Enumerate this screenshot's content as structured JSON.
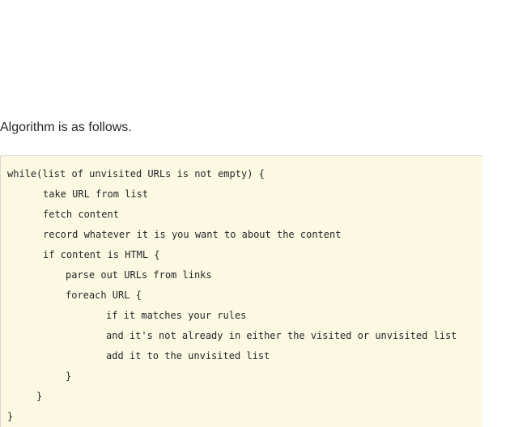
{
  "intro_text": "Algorithm is as follows.",
  "code_lines": [
    "while(list of unvisited URLs is not empty) {",
    "take URL from list",
    "fetch content",
    "record whatever it is you want to about the content",
    "if content is HTML {",
    "parse out URLs from links",
    "foreach URL {",
    "if it matches your rules",
    "and it's not already in either the visited or unvisited list",
    "add it to the unvisited list",
    "}",
    "}",
    "}"
  ]
}
